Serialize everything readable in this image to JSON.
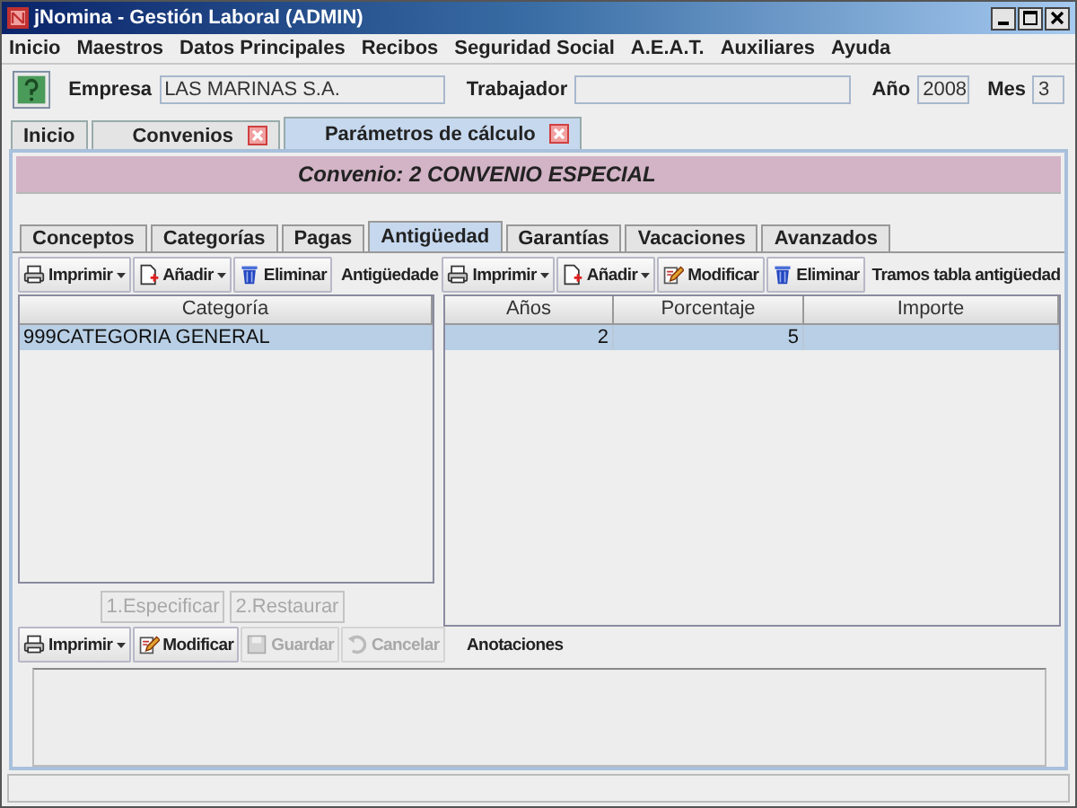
{
  "window": {
    "title": "jNomina - Gestión Laboral (ADMIN)"
  },
  "menu": [
    "Inicio",
    "Maestros",
    "Datos Principales",
    "Recibos",
    "Seguridad Social",
    "A.E.A.T.",
    "Auxiliares",
    "Ayuda"
  ],
  "header": {
    "empresa_label": "Empresa",
    "empresa": "LAS MARINAS S.A.",
    "trabajador_label": "Trabajador",
    "anio_label": "Año",
    "anio": "2008",
    "mes_label": "Mes",
    "mes": "3"
  },
  "doc_tabs": [
    {
      "label": "Inicio",
      "selected": false,
      "closable": false
    },
    {
      "label": "Convenios",
      "selected": false,
      "closable": true
    },
    {
      "label": "Parámetros de cálculo",
      "selected": true,
      "closable": true
    }
  ],
  "convenio_title": "Convenio: 2 CONVENIO ESPECIAL",
  "tabs": [
    {
      "label": "Conceptos",
      "selected": false
    },
    {
      "label": "Categorías",
      "selected": false
    },
    {
      "label": "Pagas",
      "selected": false
    },
    {
      "label": "Antigüedad",
      "selected": true
    },
    {
      "label": "Garantías",
      "selected": false
    },
    {
      "label": "Vacaciones",
      "selected": false
    },
    {
      "label": "Avanzados",
      "selected": false
    }
  ],
  "left_toolbar": [
    {
      "kind": "print",
      "label": "Imprimir",
      "dropdown": true,
      "disabled": false
    },
    {
      "kind": "add",
      "label": "Añadir",
      "dropdown": true,
      "disabled": false
    },
    {
      "kind": "delete",
      "label": "Eliminar",
      "dropdown": false,
      "disabled": false
    }
  ],
  "antiguedad_label": "Antigüedade",
  "right_toolbar": [
    {
      "kind": "print",
      "label": "Imprimir",
      "dropdown": true,
      "disabled": false
    },
    {
      "kind": "add",
      "label": "Añadir",
      "dropdown": true,
      "disabled": false
    },
    {
      "kind": "edit",
      "label": "Modificar",
      "dropdown": false,
      "disabled": false
    },
    {
      "kind": "delete",
      "label": "Eliminar",
      "dropdown": false,
      "disabled": false
    }
  ],
  "tramos_label": "Tramos tabla antigüedad",
  "categories_table": {
    "columns": [
      "Categoría"
    ],
    "rows": [
      {
        "cells": [
          "999CATEGORIA GENERAL"
        ],
        "selected": true
      }
    ]
  },
  "tramos_table": {
    "columns": [
      "Años",
      "Porcentaje",
      "Importe"
    ],
    "rows": [
      {
        "cells": [
          "2",
          "5"
        ],
        "selected": true
      }
    ]
  },
  "category_actions": [
    {
      "label": "1.Especificar",
      "disabled": true
    },
    {
      "label": "2.Restaurar",
      "disabled": true
    }
  ],
  "bottom_toolbar": [
    {
      "kind": "print",
      "label": "Imprimir",
      "dropdown": true,
      "disabled": false
    },
    {
      "kind": "edit",
      "label": "Modificar",
      "dropdown": false,
      "disabled": false
    },
    {
      "kind": "save",
      "label": "Guardar",
      "dropdown": false,
      "disabled": true
    },
    {
      "kind": "cancel",
      "label": "Cancelar",
      "dropdown": false,
      "disabled": true
    }
  ],
  "anotaciones_label": "Anotaciones"
}
